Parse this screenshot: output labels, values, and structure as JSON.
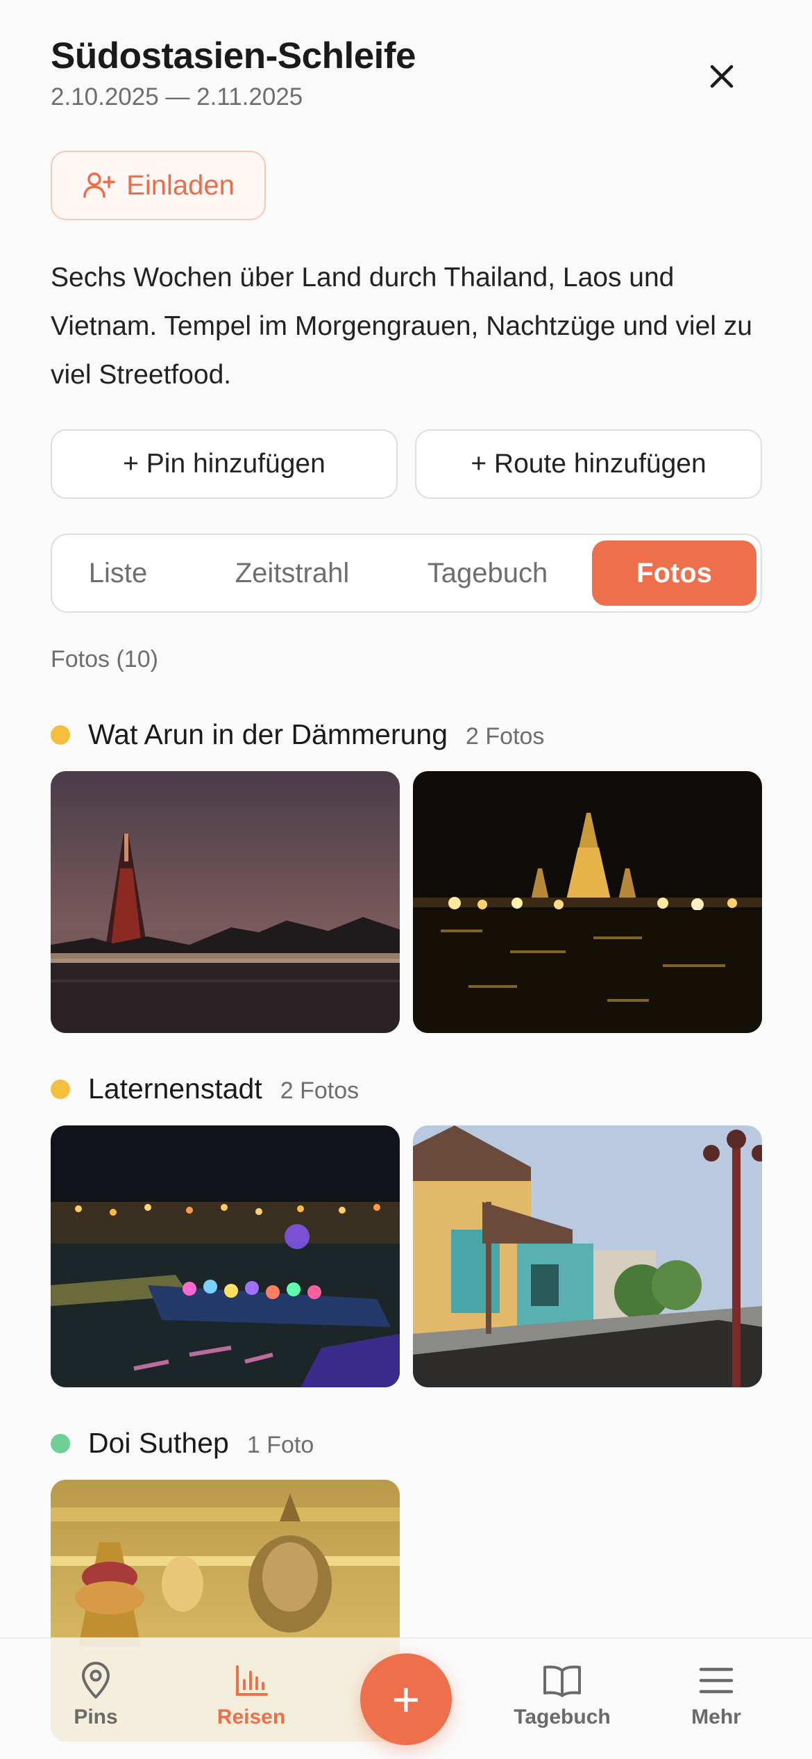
{
  "trip": {
    "title": "Südostasien-Schleife",
    "dates": "2.10.2025 — 2.11.2025",
    "invite_label": "Einladen",
    "description": "Sechs Wochen über Land durch Thailand, Laos und Vietnam. Tempel im Morgengrauen, Nachtzüge und viel zu viel Streetfood."
  },
  "actions": {
    "add_pin": "+ Pin hinzufügen",
    "add_route": "+ Route hinzufügen"
  },
  "tabs": [
    {
      "label": "Liste"
    },
    {
      "label": "Zeitstrahl"
    },
    {
      "label": "Tagebuch"
    },
    {
      "label": "Fotos",
      "active": true
    }
  ],
  "photos_section": {
    "count_label": "Fotos (10)"
  },
  "groups": [
    {
      "name": "Wat Arun in der Dämmerung",
      "count": "2 Fotos",
      "dot_color": "#f5be3e"
    },
    {
      "name": "Laternenstadt",
      "count": "2 Fotos",
      "dot_color": "#f5be3e"
    },
    {
      "name": "Doi Suthep",
      "count": "1 Foto",
      "dot_color": "#6fcf97"
    }
  ],
  "bottom_nav": {
    "pins": "Pins",
    "reisen": "Reisen",
    "add": "+",
    "tagebuch": "Tagebuch",
    "mehr": "Mehr"
  },
  "colors": {
    "accent": "#ee6f4c",
    "background": "#fafafa"
  }
}
